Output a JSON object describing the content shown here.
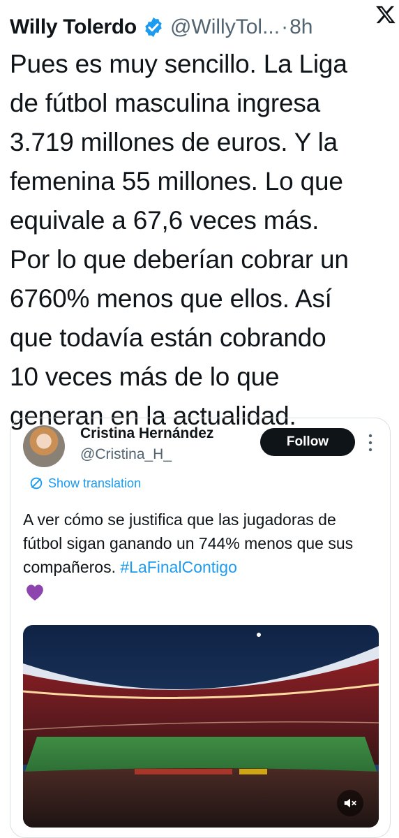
{
  "tweet": {
    "author_name": "Willy Tolerdo",
    "handle": "@WillyTol...",
    "separator": "·",
    "time": "8h",
    "text": "Pues es muy sencillo. La Liga\nde fútbol masculina ingresa\n3.719 millones de euros. Y la\nfemenina 55 millones. Lo que\nequivale a 67,6 veces más.\nPor lo que deberían cobrar un\n6760% menos que ellos. Así\nque todavía están cobrando\n10 veces más de lo que\ngeneran en la actualidad."
  },
  "quoted": {
    "author_name": "Cristina Hernández",
    "handle": "@Cristina_H_",
    "follow_label": "Follow",
    "show_translation_label": "Show translation",
    "text": "A ver cómo se justifica que las jugadoras de fútbol sigan ganando un 744% menos que sus compañeros. ",
    "hashtag": "#LaFinalContigo",
    "emoji": "purple-heart",
    "media": {
      "type": "video",
      "description": "stadium",
      "muted_icon": "speaker-muted-icon"
    }
  },
  "colors": {
    "verified": "#1d9bf0",
    "link": "#1d9bf0",
    "secondary_text": "#536471",
    "follow_bg": "#0f1419",
    "border": "#d9dee2"
  }
}
